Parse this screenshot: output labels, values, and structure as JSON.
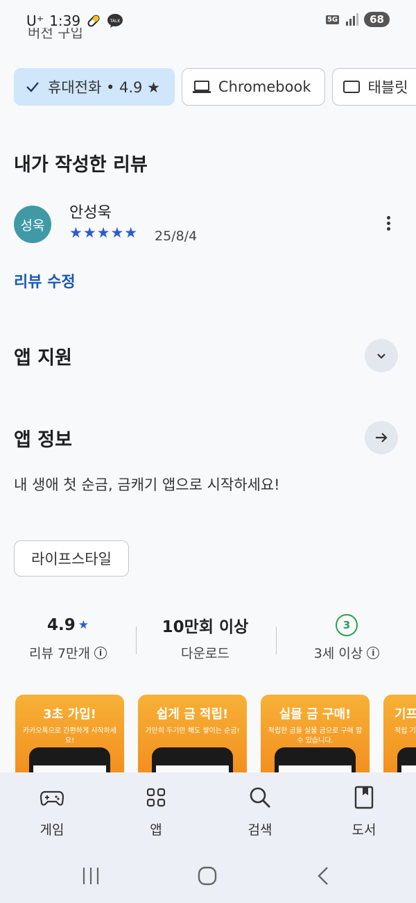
{
  "status": {
    "carrier": "U⁺",
    "time": "1:39",
    "network": "5G",
    "battery": "68",
    "talk_label": "TALK"
  },
  "partial_header": "버전 구입",
  "device_chips": [
    {
      "label": "휴대전화 • 4.9 ★",
      "selected": true,
      "icon": "check-icon"
    },
    {
      "label": "Chromebook",
      "selected": false,
      "icon": "laptop-icon"
    },
    {
      "label": "태블릿",
      "selected": false,
      "icon": "tablet-icon"
    }
  ],
  "my_review": {
    "heading": "내가 작성한 리뷰",
    "avatar_text": "성욱",
    "reviewer": "안성욱",
    "stars": "★★★★★",
    "rating": 5,
    "date": "25/8/4",
    "edit_link": "리뷰 수정"
  },
  "app_support": {
    "heading": "앱 지원"
  },
  "app_info": {
    "heading": "앱 정보",
    "description": "내 생애 첫 순금, 금캐기 앱으로 시작하세요!",
    "category_tag": "라이프스타일"
  },
  "stats": {
    "rating_value": "4.9",
    "rating_star": "★",
    "reviews_label": "리뷰 7만개",
    "downloads_value": "10만회 이상",
    "downloads_label": "다운로드",
    "age_badge": "3",
    "age_label": "3세 이상"
  },
  "screenshots": [
    {
      "title": "3초 가입!",
      "subtitle": "카카오톡으로 간편하게 시작하세요!"
    },
    {
      "title": "쉽게 금 적립!",
      "subtitle": "가만히 두기만 해도 쌓이는 순금!"
    },
    {
      "title": "실물 금 구매!",
      "subtitle": "적립한 금을 실물 금으로 구매 할 수 있습니다."
    },
    {
      "title": "기프",
      "subtitle": "적립 기프"
    }
  ],
  "bottom_nav": [
    {
      "label": "게임",
      "icon": "gamepad-icon"
    },
    {
      "label": "앱",
      "icon": "apps-grid-icon"
    },
    {
      "label": "검색",
      "icon": "search-icon"
    },
    {
      "label": "도서",
      "icon": "book-icon"
    }
  ],
  "colors": {
    "accent_blue": "#1a57b8",
    "chip_selected": "#cfe6fb",
    "avatar": "#3f9aa6",
    "age_green": "#2e9e4f",
    "screenshot_orange": "#f28a1c"
  }
}
